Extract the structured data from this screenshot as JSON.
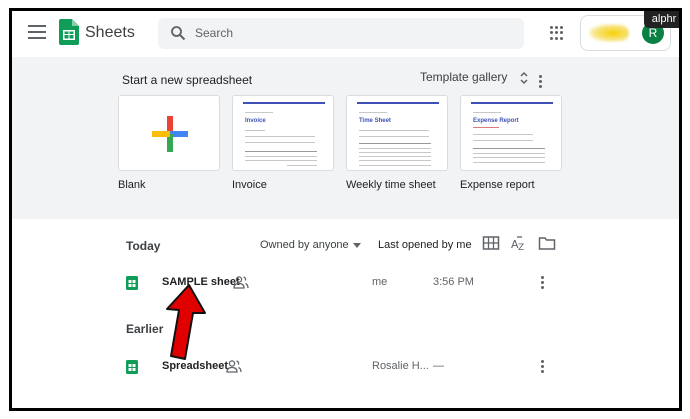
{
  "header": {
    "app_name": "Sheets",
    "search_placeholder": "Search",
    "avatar_initial": "R",
    "watermark": "alphr"
  },
  "templates": {
    "section_title": "Start a new spreadsheet",
    "gallery_label": "Template gallery",
    "items": [
      {
        "label": "Blank"
      },
      {
        "label": "Invoice",
        "doc_title": "Invoice"
      },
      {
        "label": "Weekly time sheet",
        "doc_title": "Time Sheet"
      },
      {
        "label": "Expense report",
        "doc_title": "Expense Report"
      }
    ]
  },
  "files": {
    "filter_label": "Owned by anyone",
    "sort_label": "Last opened by me",
    "groups": [
      {
        "label": "Today",
        "rows": [
          {
            "name": "SAMPLE sheet",
            "owner": "me",
            "opened": "3:56 PM",
            "shared": true
          }
        ]
      },
      {
        "label": "Earlier",
        "rows": [
          {
            "name": "Spreadsheet",
            "owner": "Rosalie H...",
            "opened": "—",
            "shared": true
          }
        ]
      }
    ]
  },
  "colors": {
    "sheets_green": "#0f9d58",
    "template_bg": "#f1f3f4",
    "avatar": "#0b8043",
    "annotation_arrow": "#e00000"
  }
}
